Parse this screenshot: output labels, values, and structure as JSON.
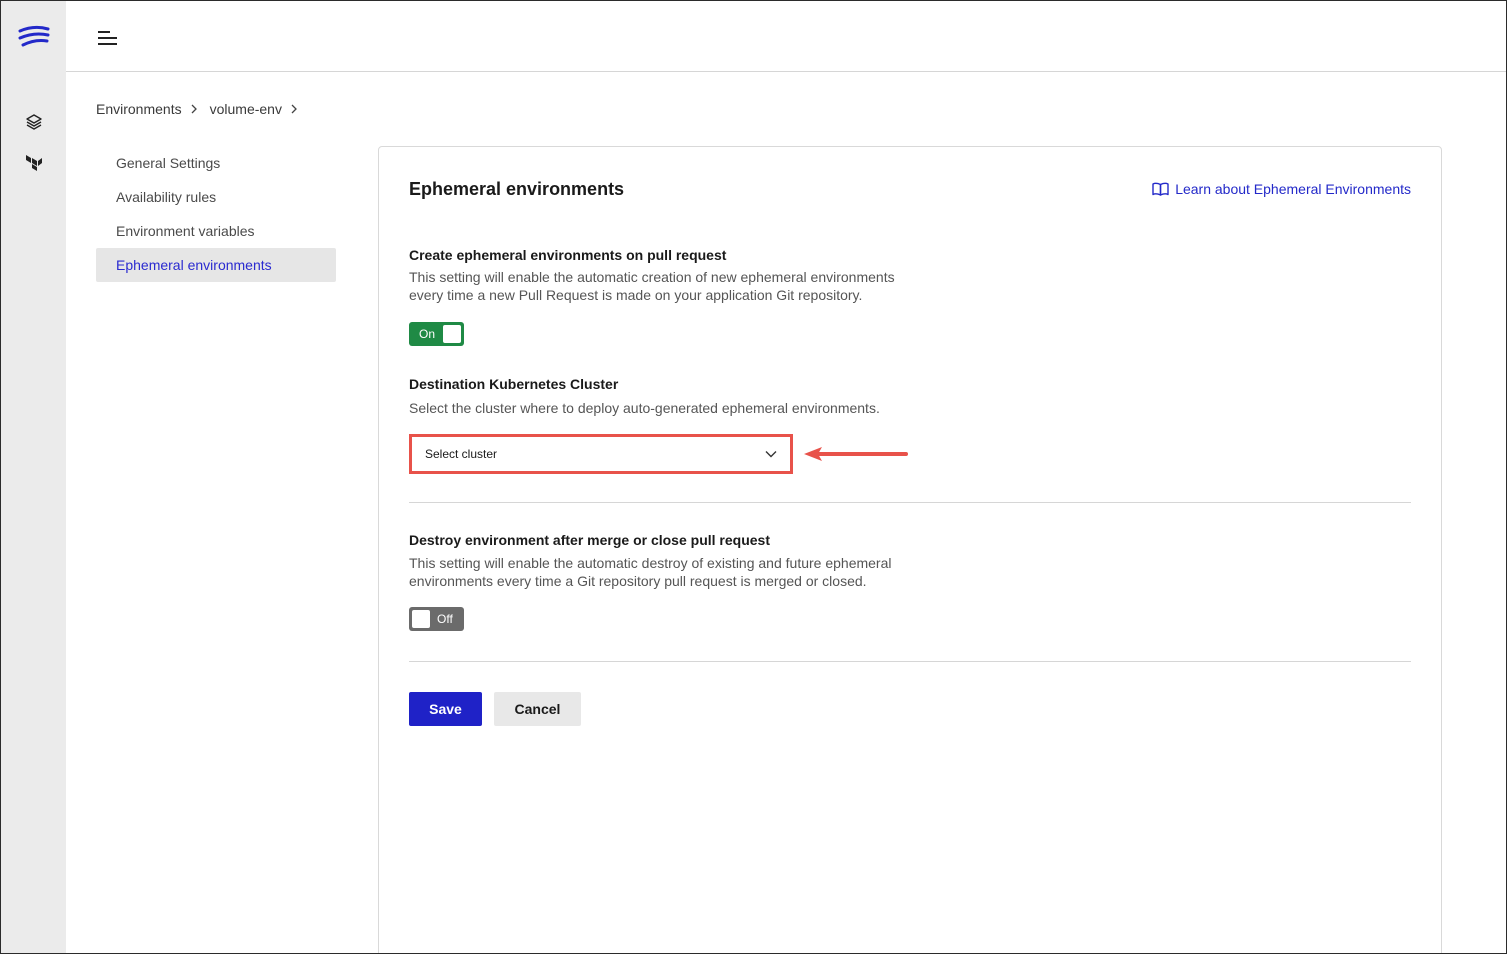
{
  "breadcrumb": [
    "Environments",
    "volume-env"
  ],
  "sidenav": {
    "items": [
      {
        "label": "General Settings",
        "active": false
      },
      {
        "label": "Availability rules",
        "active": false
      },
      {
        "label": "Environment variables",
        "active": false
      },
      {
        "label": "Ephemeral environments",
        "active": true
      }
    ]
  },
  "main": {
    "title": "Ephemeral environments",
    "learn_link": "Learn about Ephemeral Environments",
    "create_section": {
      "title": "Create ephemeral environments on pull request",
      "desc_line1": "This setting will enable the automatic creation of new ephemeral environments",
      "desc_line2": "every time a new Pull Request is made on your application Git repository.",
      "toggle_label": "On",
      "toggle_state": true
    },
    "cluster_section": {
      "title": "Destination Kubernetes Cluster",
      "desc": "Select the cluster where to deploy auto-generated ephemeral environments.",
      "select_value": "Select cluster"
    },
    "destroy_section": {
      "title": "Destroy environment after merge or close pull request",
      "desc_line1": "This setting will enable the automatic destroy of existing and future ephemeral",
      "desc_line2": "environments every time a Git repository pull request is merged or closed.",
      "toggle_label": "Off",
      "toggle_state": false
    },
    "save_label": "Save",
    "cancel_label": "Cancel"
  },
  "colors": {
    "accent": "#1f22c7",
    "link": "#2329c9",
    "toggle_on": "#1f8a45",
    "toggle_off": "#6b6b6b",
    "highlight": "#e8524a"
  },
  "icons": {
    "logo": "brand-logo-icon",
    "rail_1": "layers-icon",
    "rail_2": "terraform-icon",
    "menu": "hamburger-menu-icon",
    "book": "book-icon",
    "chevron": "chevron-down-icon"
  }
}
